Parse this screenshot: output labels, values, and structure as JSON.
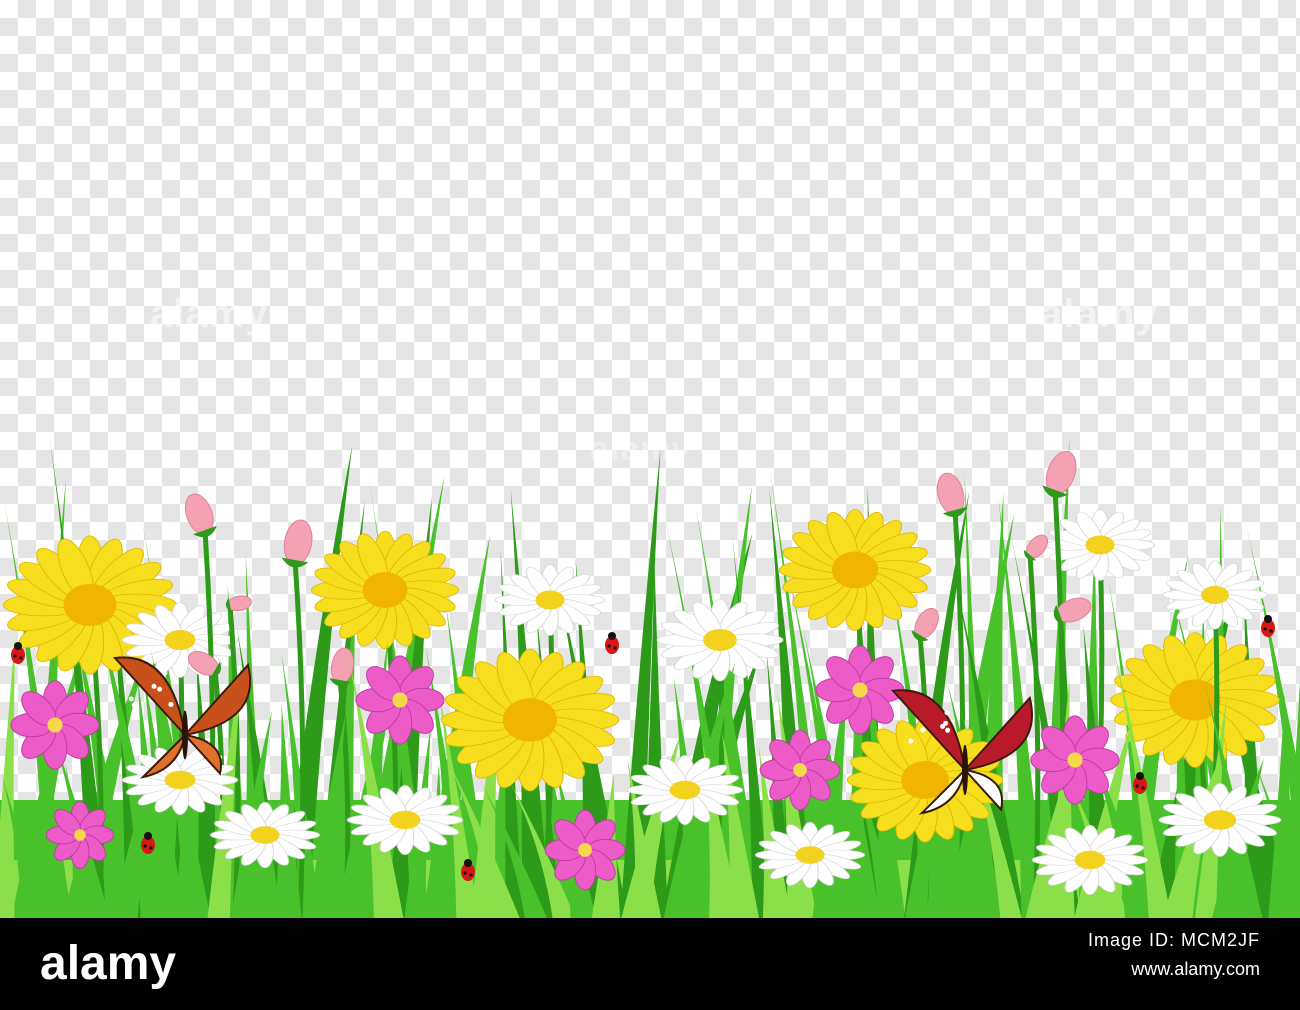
{
  "watermark": {
    "text": "alamy"
  },
  "footer": {
    "logo": "alamy",
    "image_id_label": "Image ID: MCM2JF",
    "url": "www.alamy.com"
  },
  "colors": {
    "checker_light": "#ffffff",
    "checker_dark": "#e5e5e5",
    "grass_dark": "#2e9a1a",
    "grass_mid": "#49c12a",
    "grass_light": "#8be04a",
    "daisy_petal": "#ffffff",
    "daisy_center": "#f2d21c",
    "sunflower_petal": "#f7de1f",
    "sunflower_center": "#f0b500",
    "cosmos_petal": "#ec5bc8",
    "cosmos_center": "#f5d84a",
    "bud": "#f5a1b4",
    "ladybug": "#d81818",
    "footer_bg": "#000000"
  },
  "icons": [
    "grass-blade",
    "daisy",
    "sunflower",
    "cosmos-flower",
    "pink-bud",
    "butterfly",
    "ladybug"
  ]
}
